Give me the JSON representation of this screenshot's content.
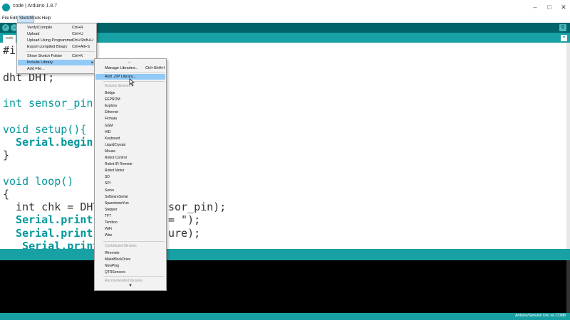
{
  "window": {
    "title": "code | Arduino 1.8.7",
    "minimize": "–",
    "maximize": "□",
    "close": "✕"
  },
  "menubar": [
    "File",
    "Edit",
    "Sketch",
    "Tools",
    "Help"
  ],
  "toolbar": {
    "verify_icon": "check-icon",
    "upload_icon": "arrow-right-icon",
    "serial_monitor_icon": "magnifier-icon"
  },
  "tab": {
    "name": "code",
    "menu_arrow": "▾"
  },
  "code_lines": [
    "#in",
    "dht DHT;",
    "int sensor_pin =",
    "void setup(){",
    "  Serial.begin(9",
    "}",
    "void loop()",
    "{",
    "  int chk = DHT",
    "  Serial.print(\"",
    "  Serial.print(D",
    "   Serial.printl"
  ],
  "code_tails": {
    "line9": "sor_pin);",
    "line10": "= \");",
    "line11": "ure);"
  },
  "sketch_menu": {
    "items": [
      {
        "label": "Verify/Compile",
        "shortcut": "Ctrl+R"
      },
      {
        "label": "Upload",
        "shortcut": "Ctrl+U"
      },
      {
        "label": "Upload Using Programmer",
        "shortcut": "Ctrl+Shift+U"
      },
      {
        "label": "Export compiled Binary",
        "shortcut": "Ctrl+Alt+S"
      },
      {
        "label": "Show Sketch Folder",
        "shortcut": "Ctrl+K"
      },
      {
        "label": "Include Library",
        "shortcut": ""
      },
      {
        "label": "Add File...",
        "shortcut": ""
      }
    ]
  },
  "library_menu": {
    "manage": {
      "label": "Manage Libraries...",
      "shortcut": "Ctrl+Shift+I"
    },
    "add_zip": "Add .ZIP Library...",
    "arduino_header": "Arduino libraries",
    "arduino_libs": [
      "Bridge",
      "EEPROM",
      "Esplora",
      "Ethernet",
      "Firmata",
      "GSM",
      "HID",
      "Keyboard",
      "LiquidCrystal",
      "Mouse",
      "Robot Control",
      "Robot IR Remote",
      "Robot Motor",
      "SD",
      "SPI",
      "Servo",
      "SoftwareSerial",
      "SpacebrewYun",
      "Stepper",
      "TFT",
      "Temboo",
      "WiFi",
      "Wire"
    ],
    "contributed_header": "Contributed libraries",
    "contributed_libs": [
      "IRremote",
      "MakeBlockDrive",
      "NewPing",
      "QTRSensors"
    ],
    "recommended_header": "Recommended libraries"
  },
  "status": {
    "board": "Arduino/Genuino Uno on COM8"
  }
}
